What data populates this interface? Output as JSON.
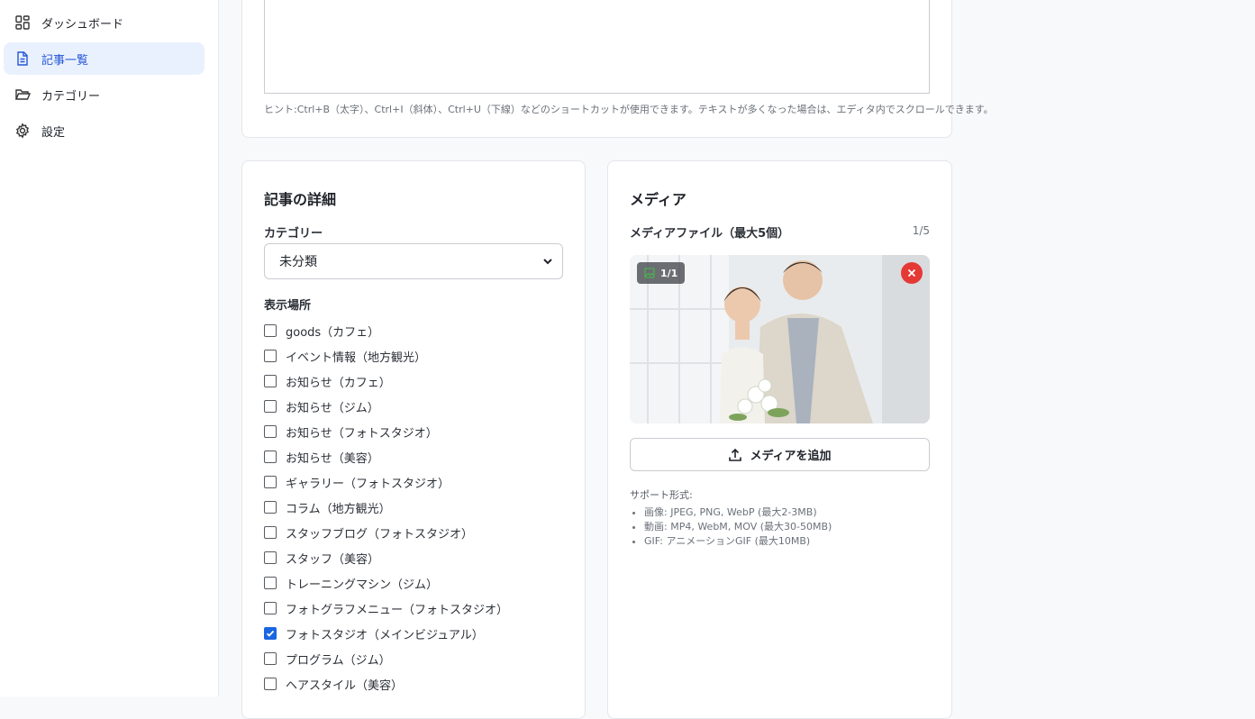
{
  "sidebar": {
    "items": [
      {
        "label": "ダッシュボード",
        "icon": "dashboard-grid-icon",
        "active": false
      },
      {
        "label": "記事一覧",
        "icon": "document-icon",
        "active": true
      },
      {
        "label": "カテゴリー",
        "icon": "folder-open-icon",
        "active": false
      },
      {
        "label": "設定",
        "icon": "gear-icon",
        "active": false
      }
    ]
  },
  "editor": {
    "hint": "ヒント:Ctrl+B（太字）、Ctrl+I（斜体）、Ctrl+U（下線）などのショートカットが使用できます。テキストが多くなった場合は、エディタ内でスクロールできます。"
  },
  "details": {
    "title": "記事の詳細",
    "category_label": "カテゴリー",
    "category_value": "未分類",
    "display_label": "表示場所",
    "display_options": [
      {
        "label": "goods（カフェ）",
        "checked": false
      },
      {
        "label": "イベント情報（地方観光）",
        "checked": false
      },
      {
        "label": "お知らせ（カフェ）",
        "checked": false
      },
      {
        "label": "お知らせ（ジム）",
        "checked": false
      },
      {
        "label": "お知らせ（フォトスタジオ）",
        "checked": false
      },
      {
        "label": "お知らせ（美容）",
        "checked": false
      },
      {
        "label": "ギャラリー（フォトスタジオ）",
        "checked": false
      },
      {
        "label": "コラム（地方観光）",
        "checked": false
      },
      {
        "label": "スタッフブログ（フォトスタジオ）",
        "checked": false
      },
      {
        "label": "スタッフ（美容）",
        "checked": false
      },
      {
        "label": "トレーニングマシン（ジム）",
        "checked": false
      },
      {
        "label": "フォトグラフメニュー（フォトスタジオ）",
        "checked": false
      },
      {
        "label": "フォトスタジオ（メインビジュアル）",
        "checked": true
      },
      {
        "label": "プログラム（ジム）",
        "checked": false
      },
      {
        "label": "ヘアスタイル（美容）",
        "checked": false
      }
    ]
  },
  "media": {
    "title": "メディア",
    "files_label": "メディアファイル（最大5個）",
    "count": "1/5",
    "item_badge": "1/1",
    "add_button": "メディアを追加",
    "support_title": "サポート形式:",
    "support_items": [
      "画像: JPEG, PNG, WebP (最大2-3MB)",
      "動画: MP4, WebM, MOV (最大30-50MB)",
      "GIF: アニメーションGIF (最大10MB)"
    ]
  },
  "colors": {
    "accent": "#1a66e0",
    "active_nav_bg": "#eaf1fe",
    "danger": "#e53935"
  }
}
